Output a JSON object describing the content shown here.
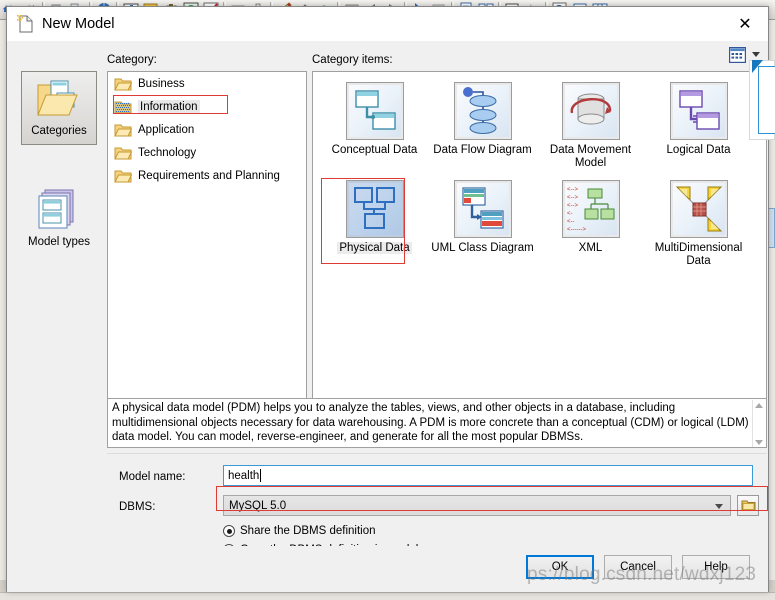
{
  "window": {
    "title": "New Model",
    "title_icon": "new-model-document-icon",
    "close_label": "✕"
  },
  "app_toolbar": {
    "icons": [
      "undo-icon",
      "redo-icon",
      "cut-icon",
      "copy-icon",
      "globe-help-icon",
      "bar-chart-icon",
      "export-icon",
      "binoculars-find-icon",
      "refresh-icon",
      "check-validate-icon",
      "rectangle-icon",
      "column-icon",
      "pencil-icon",
      "paint-bucket-icon",
      "text-font-icon",
      "shade-icon",
      "arrow-left-icon",
      "arrow-right-icon",
      "pointer-icon",
      "grid-small-icon",
      "page-icon",
      "pages-icon",
      "print-preview-icon",
      "dim-icon",
      "zoom-icon",
      "report-icon",
      "table-grid-icon"
    ]
  },
  "sidebar": {
    "items": [
      {
        "label": "Categories",
        "icon": "folder-pages-icon",
        "selected": true
      },
      {
        "label": "Model types",
        "icon": "stacked-pages-icon",
        "selected": false
      }
    ]
  },
  "category": {
    "label": "Category:",
    "items": [
      {
        "label": "Business",
        "icon": "folder-icon",
        "selected": false
      },
      {
        "label": "Information",
        "icon": "folder-selected-icon",
        "selected": true
      },
      {
        "label": "Application",
        "icon": "folder-icon",
        "selected": false
      },
      {
        "label": "Technology",
        "icon": "folder-icon",
        "selected": false
      },
      {
        "label": "Requirements and Planning",
        "icon": "folder-icon",
        "selected": false
      }
    ]
  },
  "category_items": {
    "label": "Category items:",
    "view_icon": "list-view-icon",
    "view_chevron_icon": "chevron-down-icon",
    "items": [
      {
        "label": "Conceptual Data",
        "icon": "conceptual-data-icon",
        "selected": false
      },
      {
        "label": "Data Flow Diagram",
        "icon": "data-flow-diagram-icon",
        "selected": false
      },
      {
        "label": "Data Movement Model",
        "icon": "data-movement-model-icon",
        "selected": false
      },
      {
        "label": "Logical Data",
        "icon": "logical-data-icon",
        "selected": false
      },
      {
        "label": "Physical Data",
        "icon": "physical-data-icon",
        "selected": true
      },
      {
        "label": "UML Class Diagram",
        "icon": "uml-class-diagram-icon",
        "selected": false
      },
      {
        "label": "XML",
        "icon": "xml-icon",
        "selected": false
      },
      {
        "label": "MultiDimensional Data",
        "icon": "multidimensional-data-icon",
        "selected": false
      }
    ]
  },
  "description": {
    "text": "A physical data model (PDM) helps you to analyze the tables, views, and other objects in a database, including multidimensional objects necessary for data warehousing. A PDM is more concrete than a conceptual (CDM) or logical (LDM) data model. You can model, reverse-engineer, and generate for all the most popular DBMSs.",
    "scroll_up_icon": "scroll-up-arrow-icon",
    "scroll_down_icon": "scroll-down-arrow-icon"
  },
  "form": {
    "model_name_label": "Model name:",
    "model_name_value": "health",
    "model_name_placeholder": "",
    "dbms_label": "DBMS:",
    "dbms_value": "MySQL 5.0",
    "dbms_options": [
      "MySQL 5.0"
    ],
    "dbms_browse_icon": "folder-browse-icon",
    "dbms_chevron_icon": "chevron-down-icon",
    "radios": [
      {
        "label": "Share the DBMS definition",
        "checked": true
      },
      {
        "label": "Copy the DBMS definition in model",
        "checked": false
      }
    ]
  },
  "footer": {
    "ok_label": "OK",
    "cancel_label": "Cancel",
    "help_label": "Help"
  },
  "overlay": {
    "watermark_text": "ps://blog.csdn.net/wdxj123",
    "cursor_icon": "arrow-cursor-icon"
  },
  "colors": {
    "accent_blue": "#0078d7",
    "annotation_red": "#e03a32",
    "dialog_bg": "#f0f0f0",
    "panel_white": "#ffffff"
  }
}
